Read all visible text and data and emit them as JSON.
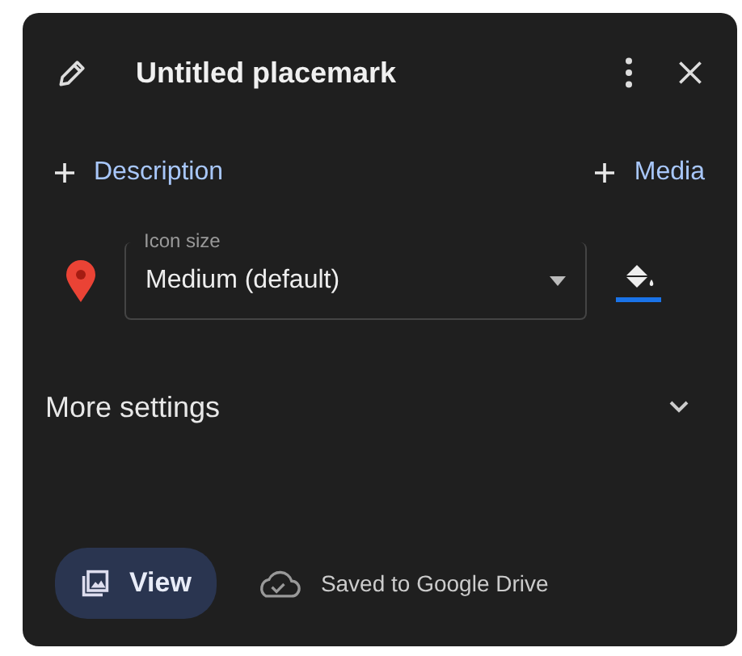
{
  "header": {
    "title": "Untitled placemark"
  },
  "add_buttons": [
    {
      "label": "Description"
    },
    {
      "label": "Media"
    }
  ],
  "icon_size": {
    "label": "Icon size",
    "value": "Medium (default)"
  },
  "more_settings": {
    "label": "More settings",
    "expanded": false
  },
  "footer": {
    "view_button": "View",
    "status": "Saved to Google Drive"
  }
}
